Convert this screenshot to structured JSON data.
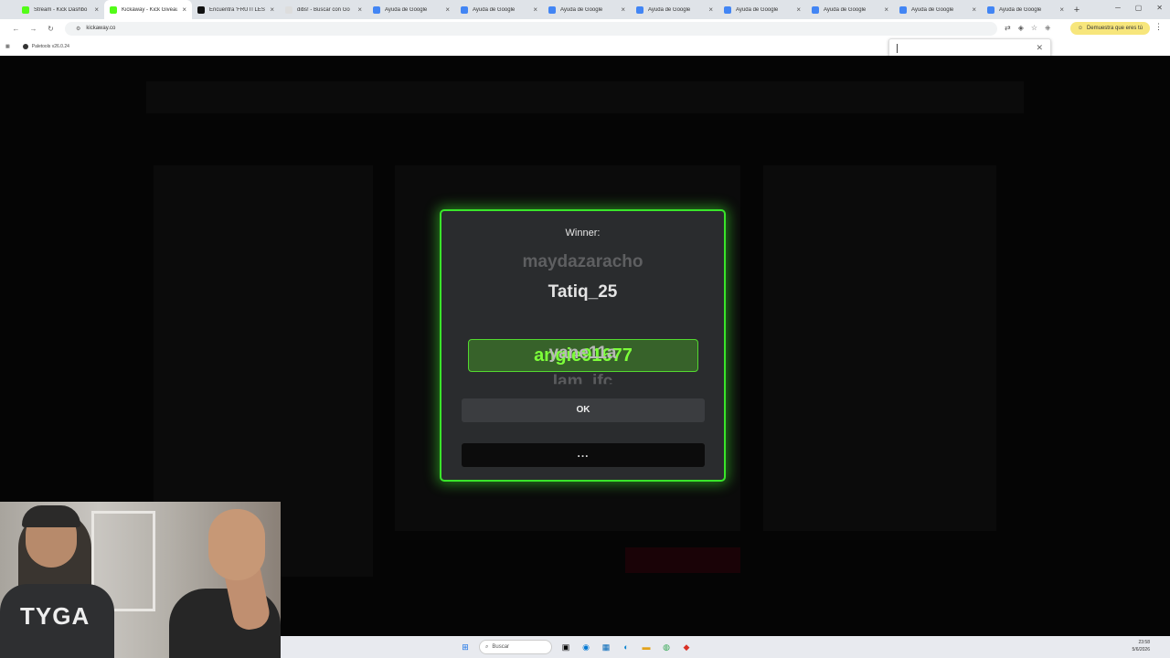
{
  "browser": {
    "tabs": [
      {
        "title": "Stream - Kick Dashbo",
        "color": "#53fc18",
        "active": false
      },
      {
        "title": "Kickaway - Kick Giveau",
        "color": "#53fc18",
        "active": true
      },
      {
        "title": "Encuentra 'FRUTI LES",
        "color": "#111111",
        "active": false
      },
      {
        "title": "dibs! - Buscar con Go",
        "color": "#dddddd",
        "active": false
      },
      {
        "title": "Ayuda de Google",
        "color": "#4285f4",
        "active": false
      },
      {
        "title": "Ayuda de Google",
        "color": "#4285f4",
        "active": false
      },
      {
        "title": "Ayuda de Google",
        "color": "#4285f4",
        "active": false
      },
      {
        "title": "Ayuda de Google",
        "color": "#4285f4",
        "active": false
      },
      {
        "title": "Ayuda de Google",
        "color": "#4285f4",
        "active": false
      },
      {
        "title": "Ayuda de Google",
        "color": "#4285f4",
        "active": false
      },
      {
        "title": "Ayuda de Google",
        "color": "#4285f4",
        "active": false
      },
      {
        "title": "Ayuda de Google",
        "color": "#4285f4",
        "active": false
      }
    ],
    "url": "kickaway.co",
    "promo": "Demuestra que eres tú",
    "bookmark": "Paletools v26.0.24"
  },
  "modal": {
    "label": "Winner:",
    "names": [
      "maydazaracho",
      "Tatiq_25",
      "angie91677",
      "yane11a",
      "Iam_ifc"
    ],
    "ok": "OK",
    "more": "..."
  },
  "cam": {
    "shirt_text": "TYGA"
  },
  "taskbar": {
    "search": "Buscar",
    "time": "23:58",
    "date": "5/6/2026"
  },
  "colors": {
    "accent": "#53fc18",
    "modal_bg": "#2a2c2e",
    "winner_box": "#37622a"
  }
}
